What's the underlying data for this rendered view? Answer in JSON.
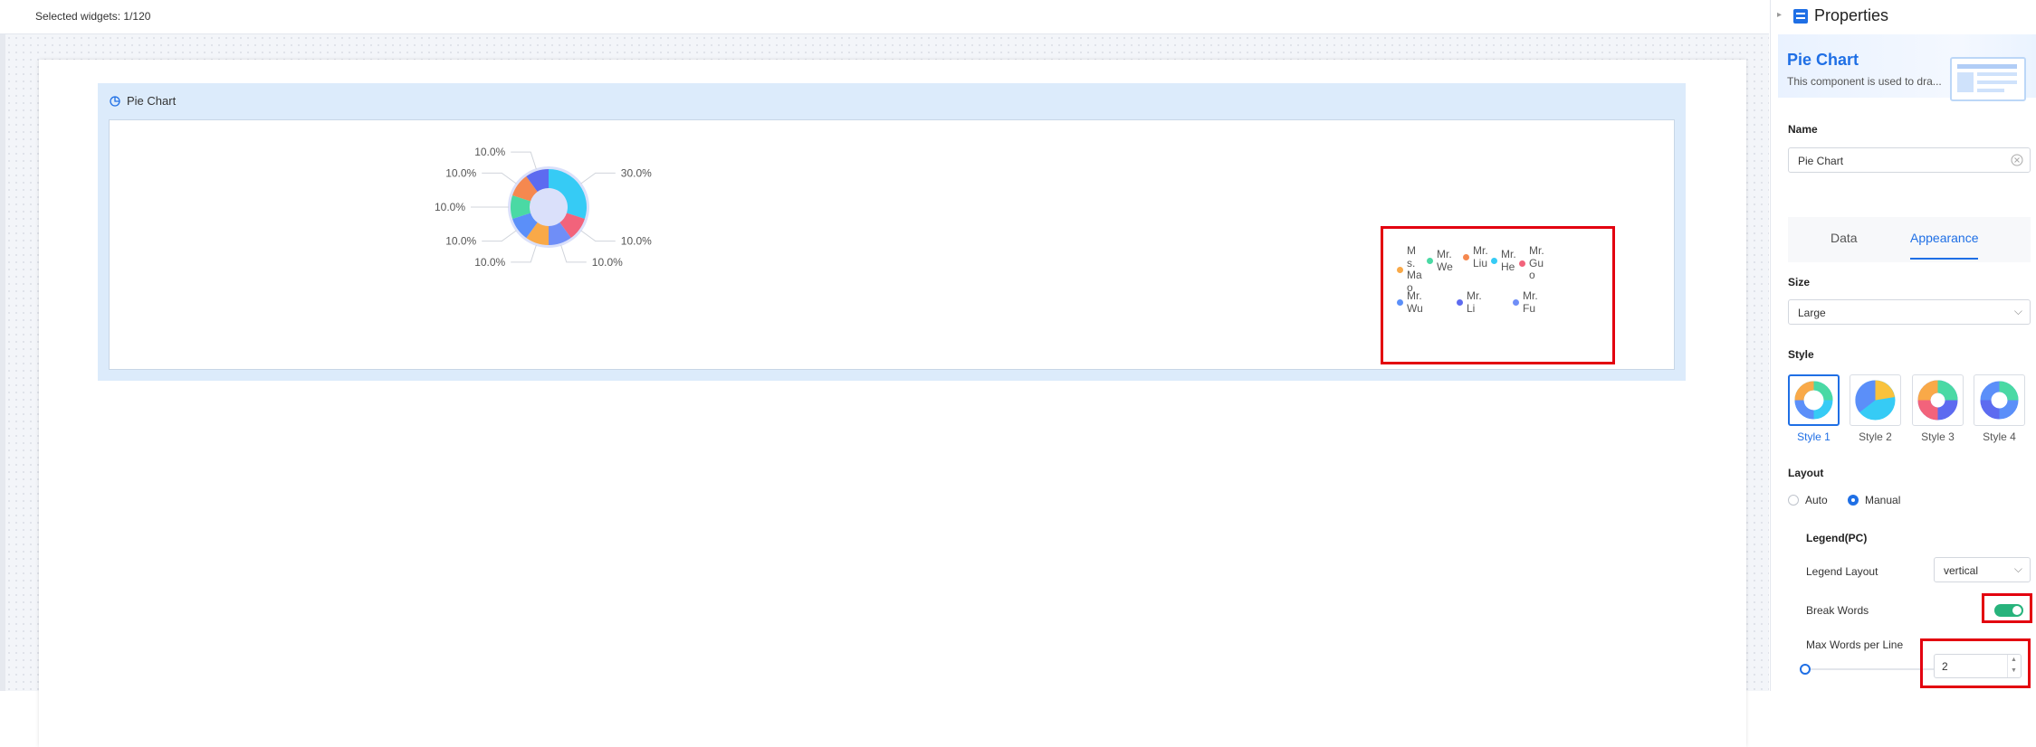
{
  "topbar": {
    "selected_text": "Selected widgets: 1/120"
  },
  "widget": {
    "title": "Pie Chart"
  },
  "chart_data": {
    "type": "pie",
    "style": "donut",
    "labels": [
      "Mr. Wei",
      "Mr. Liu",
      "Mr. He",
      "Mr. Guo",
      "Mr. Wu",
      "Mr. Li",
      "Mr. Fu",
      "Ms. Mao"
    ],
    "values": [
      30,
      10,
      10,
      10,
      10,
      10,
      10,
      10
    ],
    "percent_labels": [
      "30.0%",
      "10.0%",
      "10.0%",
      "10.0%",
      "10.0%",
      "10.0%",
      "10.0%",
      "10.0%"
    ],
    "colors": [
      "#36cbf5",
      "#f2637b",
      "#6f8ef7",
      "#f9a948",
      "#5b8ff9",
      "#4ad9a4",
      "#f5884f",
      "#5d6bf0"
    ],
    "legend": {
      "placement": "right",
      "items": [
        {
          "label": "Ms.Mao",
          "color": "#f9a948"
        },
        {
          "label": "Mr.We",
          "color": "#4ad9a4"
        },
        {
          "label": "Mr.Liu",
          "color": "#f5884f"
        },
        {
          "label": "Mr.He",
          "color": "#36cbf5"
        },
        {
          "label": "Mr.Guo",
          "color": "#f2637b"
        },
        {
          "label": "Mr.Wu",
          "color": "#5b8ff9"
        },
        {
          "label": "Mr.Li",
          "color": "#5d6bf0"
        },
        {
          "label": "Mr.Fu",
          "color": "#6f8ef7"
        }
      ]
    }
  },
  "panel": {
    "title": "Properties",
    "banner_title": "Pie Chart",
    "banner_desc": "This component is used to dra...",
    "name_label": "Name",
    "name_value": "Pie Chart",
    "tab_data": "Data",
    "tab_appearance": "Appearance",
    "size_label": "Size",
    "size_value": "Large",
    "style_label": "Style",
    "styles": [
      "Style 1",
      "Style 2",
      "Style 3",
      "Style 4"
    ],
    "layout_label": "Layout",
    "layout_auto": "Auto",
    "layout_manual": "Manual",
    "legend_pc_label": "Legend(PC)",
    "legend_layout_label": "Legend Layout",
    "legend_layout_value": "vertical",
    "break_words_label": "Break Words",
    "break_words_on": true,
    "max_words_label": "Max Words per Line",
    "max_words_value": "2"
  }
}
